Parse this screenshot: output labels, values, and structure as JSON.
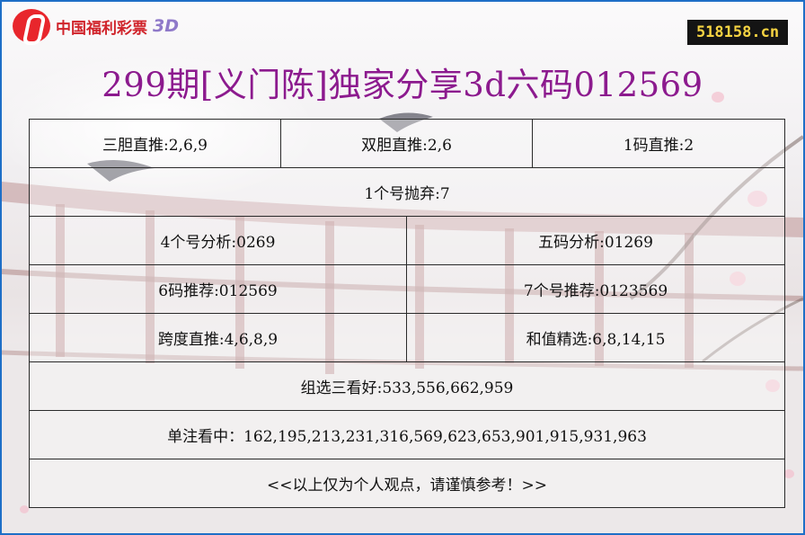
{
  "header": {
    "logo_text": "中国福利彩票",
    "logo_3d": "3D",
    "site": "518158.cn"
  },
  "title": "299期[义门陈]独家分享3d六码012569",
  "grid": {
    "row1": [
      "三胆直推:2,6,9",
      "双胆直推:2,6",
      "1码直推:2"
    ],
    "row2": "1个号抛弃:7",
    "row3": [
      "4个号分析:0269",
      "五码分析:01269"
    ],
    "row4": [
      "6码推荐:012569",
      "7个号推荐:0123569"
    ],
    "row5": [
      "跨度直推:4,6,8,9",
      "和值精选:6,8,14,15"
    ],
    "row6": "组选三看好:533,556,662,959",
    "row7": "单注看中：162,195,213,231,316,569,623,653,901,915,931,963",
    "row8": "<<以上仅为个人观点，请谨慎参考！>>"
  }
}
